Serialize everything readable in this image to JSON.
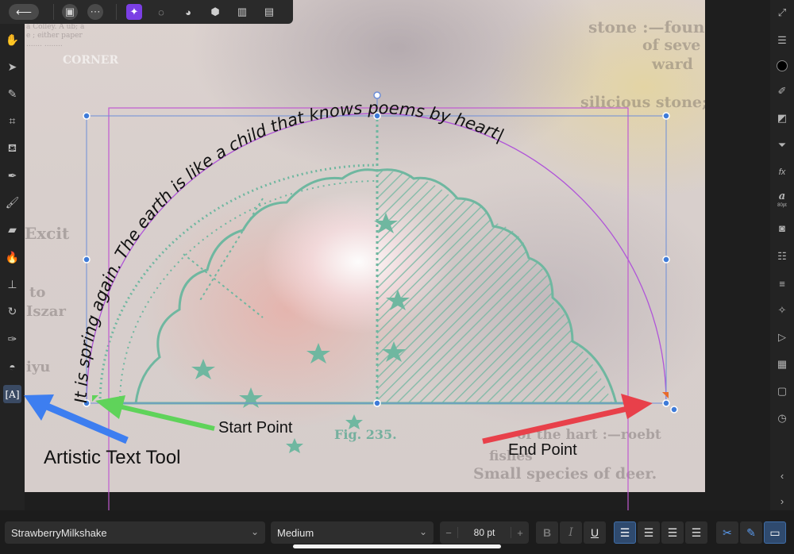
{
  "top_toolbar": {
    "back_icon": "arrow-left-icon",
    "buttons": [
      "document-icon",
      "more-icon"
    ],
    "personas": [
      "designer-persona-icon",
      "develop-persona-icon",
      "pixel-persona-icon",
      "export-persona-icon",
      "tone-map-icon",
      "photo-persona-icon"
    ]
  },
  "artwork": {
    "curved_text": "It is spring again. The earth is like a child that knows poems by heart|",
    "fig_caption": "Fig. 235.",
    "bg_words": {
      "stone": "stone :—foun",
      "of_seve": "of seve",
      "ward": "ward",
      "silicious": "silicious stone;",
      "excit": "Excit",
      "to": "to",
      "iszar": "Iszar",
      "iyu": "iyu",
      "hart": "of the hart :—roebt",
      "fishes": "fishes",
      "small_species": "Small species of deer.",
      "corner": "CORNER"
    }
  },
  "annotations": {
    "artistic_text_tool": "Artistic Text Tool",
    "start_point": "Start Point",
    "end_point": "End Point",
    "blue": "#3d7ef0",
    "green": "#5fd35a",
    "red": "#e8404a"
  },
  "right_panel": {
    "font_size_label": "80pt"
  },
  "bottom_bar": {
    "font_family": "StrawberryMilkshake",
    "font_style": "Medium",
    "font_size": "80 pt",
    "minus": "−",
    "plus": "+",
    "bold": "B",
    "italic": "I",
    "underline": "U"
  }
}
